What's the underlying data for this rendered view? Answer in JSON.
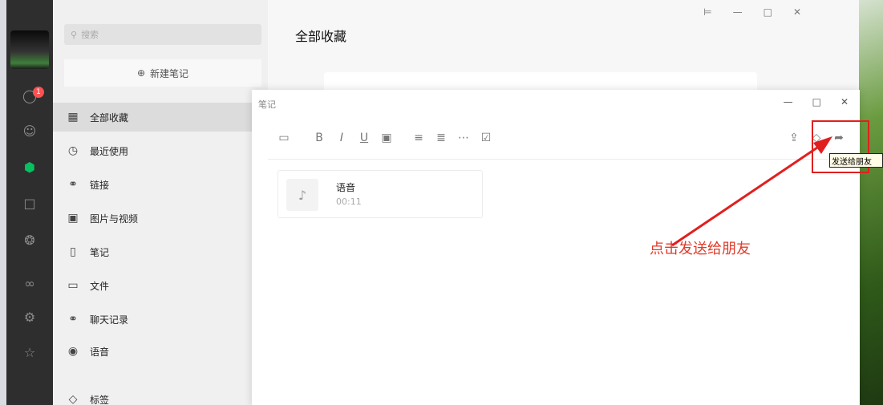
{
  "colors": {
    "accent_green": "#07c160",
    "annotation_red": "#e0201e",
    "sidebar_bg": "#f0f0f0",
    "iconbar_bg": "#2e2e2e"
  },
  "iconbar": {
    "badge_count": "1",
    "icons": [
      "chat-icon",
      "contacts-icon",
      "favorites-icon",
      "folder-icon",
      "moments-icon",
      "mini-program-icon",
      "settings-icon",
      "star-icon"
    ]
  },
  "sidebar": {
    "search_placeholder": "搜索",
    "new_note_label": "新建笔记",
    "items": [
      {
        "label": "全部收藏",
        "icon": "grid-icon",
        "active": true
      },
      {
        "label": "最近使用",
        "icon": "clock-icon"
      },
      {
        "label": "链接",
        "icon": "link-icon"
      },
      {
        "label": "图片与视频",
        "icon": "image-icon"
      },
      {
        "label": "笔记",
        "icon": "note-icon"
      },
      {
        "label": "文件",
        "icon": "folder-icon"
      },
      {
        "label": "聊天记录",
        "icon": "chat-record-icon"
      },
      {
        "label": "语音",
        "icon": "voice-icon"
      },
      {
        "label": "标签",
        "icon": "tag-icon"
      }
    ]
  },
  "main": {
    "title": "全部收藏"
  },
  "note_window": {
    "title": "笔记",
    "toolbar_icons": [
      "folder-icon",
      "bold-icon",
      "italic-icon",
      "underline-icon",
      "textbox-icon",
      "bullet-list-icon",
      "numbered-list-icon",
      "divider-icon",
      "checkbox-icon"
    ],
    "toolbar_right_icons": [
      "upload-icon",
      "tag-icon",
      "share-icon"
    ],
    "voice": {
      "name": "语音",
      "duration": "00:11"
    },
    "tooltip": "发送给朋友"
  },
  "annotation": {
    "text": "点击发送给朋友"
  }
}
